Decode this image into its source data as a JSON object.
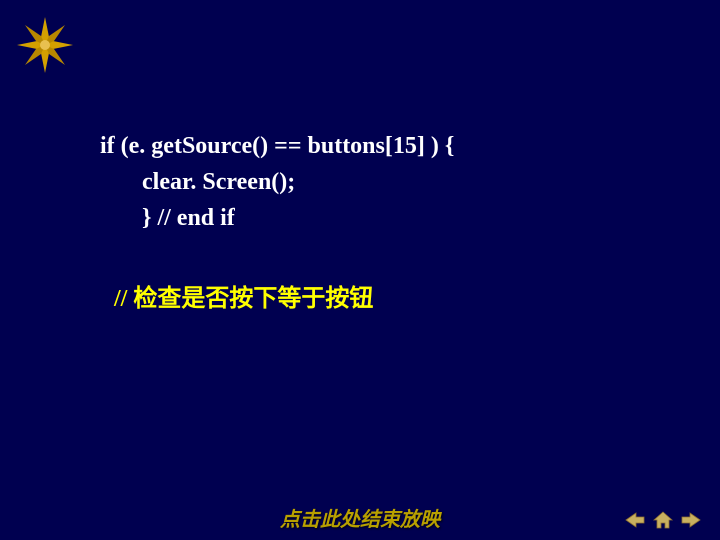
{
  "code": {
    "line1": "if (e. getSource() == buttons[15] ) {",
    "line2": "clear. Screen();",
    "line3": "}  // end if"
  },
  "comment": "// 检查是否按下等于按钮",
  "footer": {
    "end_link": "点击此处结束放映"
  },
  "icons": {
    "star": "star-decoration",
    "prev": "prev-arrow-icon",
    "home": "home-icon",
    "next": "next-arrow-icon"
  },
  "colors": {
    "bg": "#000050",
    "code": "#ffffff",
    "comment": "#ffff00",
    "accent": "#d4a000",
    "nav": "#c8b060"
  }
}
